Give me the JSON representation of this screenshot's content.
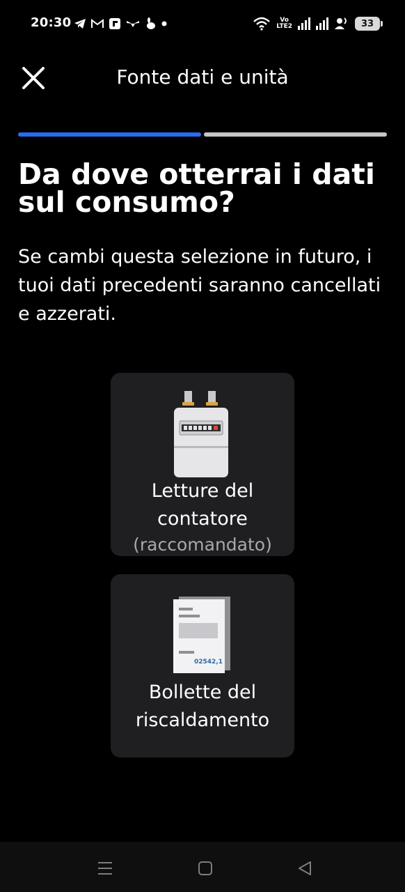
{
  "status_bar": {
    "time": "20:30",
    "battery": "33",
    "volte_top": "Vo",
    "volte_bottom": "LTE2",
    "left_icons": [
      "telegram-icon",
      "gmail-icon",
      "flipboard-icon",
      "wings-icon",
      "rabbit-icon",
      "dot-icon"
    ],
    "right_icons": [
      "wifi-icon",
      "volte-icon",
      "signal-icon",
      "signal-icon",
      "hotspot-person-icon",
      "battery-icon"
    ]
  },
  "header": {
    "title": "Fonte dati e unità",
    "close_icon": "close-icon"
  },
  "progress": {
    "step": 1,
    "total": 2
  },
  "question": {
    "title": "Da dove otterrai i dati sul consumo?",
    "description": "Se cambi questa selezione in futuro, i tuoi dati precedenti saranno cancellati e azzerati."
  },
  "options": [
    {
      "icon": "gas-meter-icon",
      "label": "Letture del contatore",
      "sublabel": "(raccomandato)"
    },
    {
      "icon": "bill-document-icon",
      "label": "Bollette del riscaldamento",
      "bill_number": "02542,1"
    }
  ],
  "nav_bar": {
    "icons": [
      "menu-icon",
      "home-icon",
      "back-icon"
    ]
  },
  "colors": {
    "background": "#000000",
    "accent": "#2a6cf0",
    "card": "#1f1f21",
    "muted_text": "#a8a8ae",
    "progress_inactive": "#c6c6c6"
  }
}
